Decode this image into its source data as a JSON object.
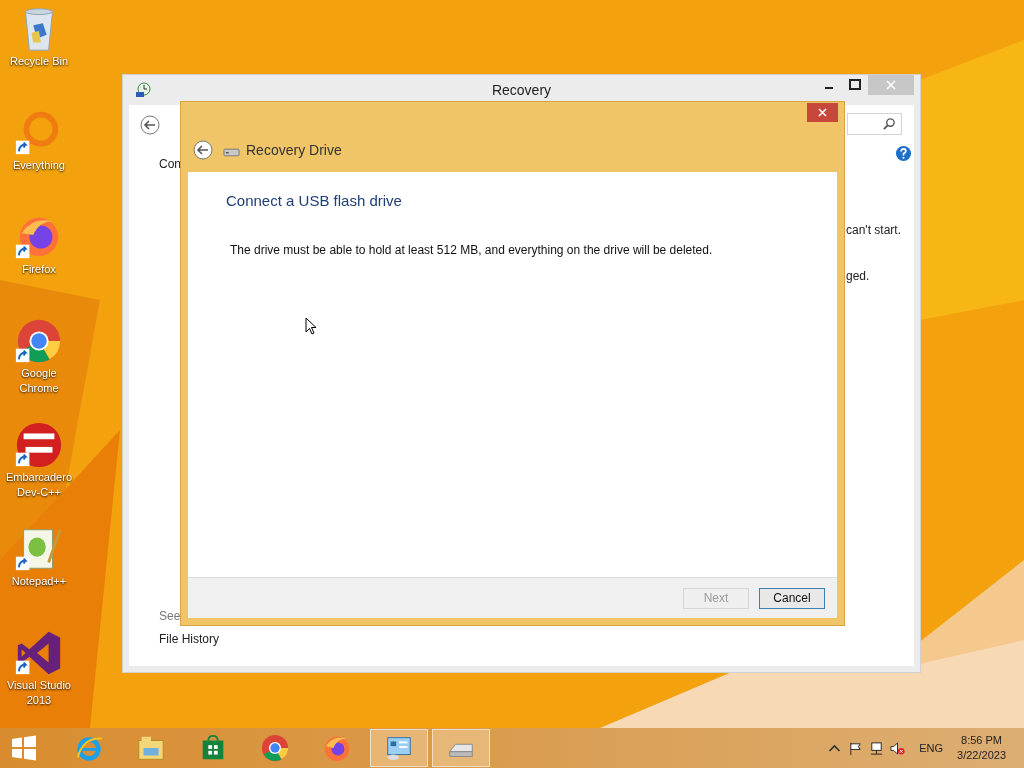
{
  "desktop_icons": [
    {
      "kind": "recycle",
      "label": "Recycle Bin",
      "shortcut": false
    },
    {
      "kind": "everything",
      "label": "Everything",
      "shortcut": true
    },
    {
      "kind": "firefox",
      "label": "Firefox",
      "shortcut": true
    },
    {
      "kind": "chrome",
      "label": "Google Chrome",
      "shortcut": true
    },
    {
      "kind": "devcpp",
      "label": "Embarcadero Dev-C++",
      "shortcut": true
    },
    {
      "kind": "notepad",
      "label": "Notepad++",
      "shortcut": true
    },
    {
      "kind": "vs",
      "label": "Visual Studio 2013",
      "shortcut": true
    }
  ],
  "back_window": {
    "title": "Recovery",
    "partial_texts": [
      "Con",
      "can't start.",
      "ged.",
      "See"
    ],
    "link": "File History"
  },
  "dialog": {
    "title": "Recovery Drive",
    "heading": "Connect a USB flash drive",
    "message": "The drive must be able to hold at least 512 MB, and everything on the drive will be deleted.",
    "buttons": [
      {
        "label": "Next",
        "disabled": true
      },
      {
        "label": "Cancel",
        "disabled": false
      }
    ]
  },
  "taskbar": {
    "apps": [
      {
        "kind": "ie",
        "active": false
      },
      {
        "kind": "explorer",
        "active": false
      },
      {
        "kind": "store",
        "active": false
      },
      {
        "kind": "chrome",
        "active": false
      },
      {
        "kind": "firefox",
        "active": false
      },
      {
        "kind": "control",
        "active": true
      },
      {
        "kind": "drive",
        "active": true
      }
    ],
    "language": "ENG",
    "time": "8:56 PM",
    "date": "3/22/2023"
  }
}
